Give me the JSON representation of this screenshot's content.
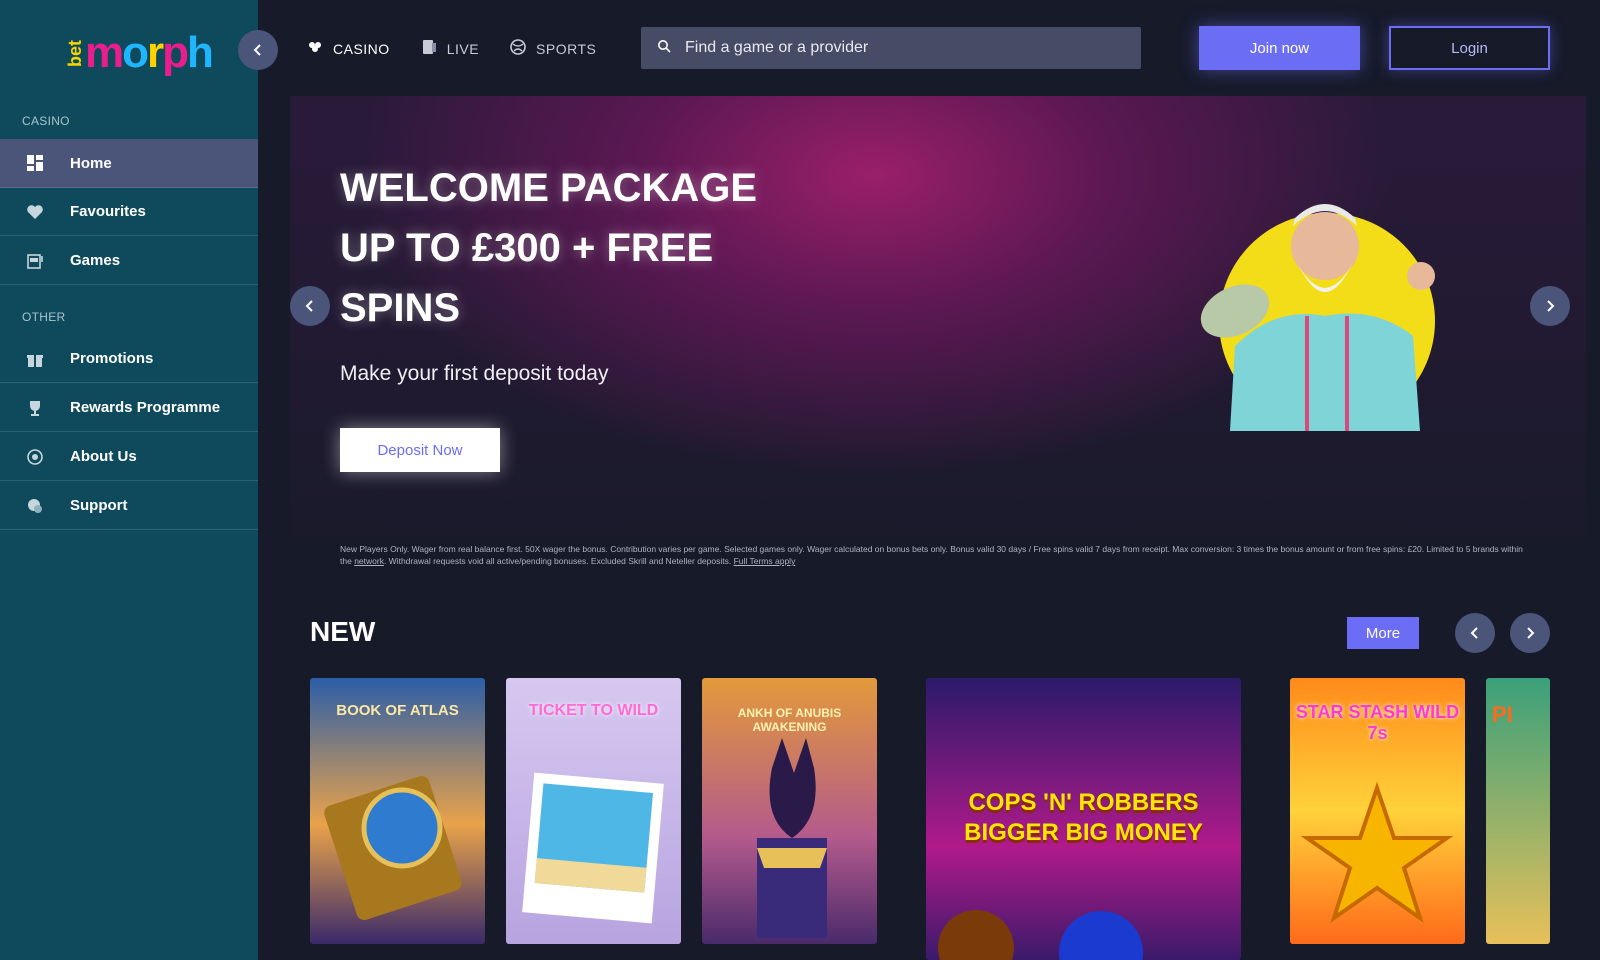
{
  "brand": {
    "logo_bet": "bet",
    "logo_word": [
      "m",
      "o",
      "r",
      "p",
      "h"
    ]
  },
  "sidebar": {
    "casino_label": "CASINO",
    "other_label": "OTHER",
    "items": [
      {
        "label": "Home",
        "icon": "grid-icon",
        "active": true
      },
      {
        "label": "Favourites",
        "icon": "heart-icon"
      },
      {
        "label": "Games",
        "icon": "slot-machine-icon"
      },
      {
        "label": "Promotions",
        "icon": "gift-icon"
      },
      {
        "label": "Rewards Programme",
        "icon": "trophy-icon"
      },
      {
        "label": "About Us",
        "icon": "info-icon"
      },
      {
        "label": "Support",
        "icon": "chat-icon"
      }
    ]
  },
  "topnav": {
    "casino": "CASINO",
    "live": "LIVE",
    "sports": "SPORTS"
  },
  "search": {
    "placeholder": "Find a game or a provider"
  },
  "auth": {
    "join": "Join now",
    "login": "Login"
  },
  "hero": {
    "title": "WELCOME PACKAGE UP TO £300 + FREE SPINS",
    "subtitle": "Make your first deposit today",
    "cta": "Deposit Now"
  },
  "terms": {
    "text1": "New Players Only. Wager from real balance first. 50X wager the bonus. Contribution varies per game. Selected games only. Wager calculated on bonus bets only. Bonus valid 30 days / Free spins valid 7 days from receipt. Max conversion: 3 times the bonus amount or from free spins: £20. Limited to 5 brands within the ",
    "link1": "network",
    "text2": ". Withdrawal requests void all active/pending bonuses. Excluded Skrill and Neteller deposits. ",
    "link2": "Full Terms apply"
  },
  "new_section": {
    "title": "NEW",
    "more": "More",
    "games": [
      {
        "title": "BOOK OF ATLAS"
      },
      {
        "title": "TICKET TO WILD"
      },
      {
        "title": "ANKH OF ANUBIS AWAKENING"
      },
      {
        "title": "COPS 'N' ROBBERS BIGGER BIG MONEY"
      },
      {
        "title": "STAR STASH WILD 7s"
      },
      {
        "title": "PI"
      }
    ]
  }
}
